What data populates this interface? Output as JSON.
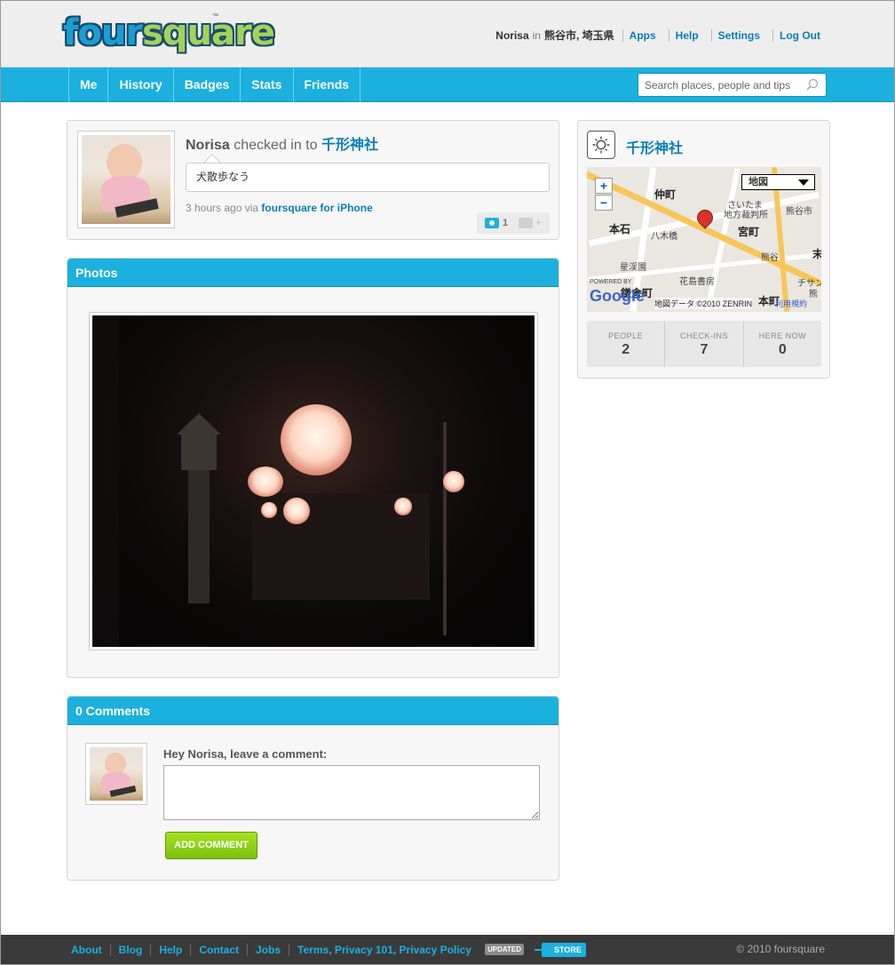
{
  "header": {
    "logo_four": "four",
    "logo_square": "square",
    "logo_tm": "™",
    "user_name": "Norisa",
    "in_word": "in",
    "location": "熊谷市, 埼玉県",
    "links": [
      "Apps",
      "Help",
      "Settings",
      "Log Out"
    ]
  },
  "nav": {
    "items": [
      "Me",
      "History",
      "Badges",
      "Stats",
      "Friends"
    ],
    "search_placeholder": "Search places, people and tips"
  },
  "checkin": {
    "user": "Norisa",
    "action": "checked in to",
    "venue": "千形神社",
    "shout": "犬散歩なう",
    "time": "3 hours ago via",
    "via": "foursquare for iPhone",
    "photo_count": "1",
    "comment_plus": "+"
  },
  "photos": {
    "title": "Photos"
  },
  "comments": {
    "title": "0 Comments",
    "prompt": "Hey Norisa, leave a comment:",
    "button": "ADD COMMENT"
  },
  "venue": {
    "name": "千形神社",
    "map": {
      "type_select": "地図",
      "zoom_in": "+",
      "zoom_out": "−",
      "labels": [
        "仲町",
        "本石",
        "宮町",
        "八木橋",
        "さいたま",
        "地方裁判所",
        "熊谷市",
        "熊谷",
        "星渓園",
        "花島書房",
        "鎌倉町",
        "本町",
        "チサン",
        "熊",
        "末"
      ],
      "google": "Google",
      "copyright": "地図データ ©2010 ZENRIN",
      "terms": "利用規約",
      "powered": "POWERED BY"
    },
    "stats": [
      {
        "label": "PEOPLE",
        "value": "2"
      },
      {
        "label": "CHECK-INS",
        "value": "7"
      },
      {
        "label": "HERE NOW",
        "value": "0"
      }
    ]
  },
  "footer": {
    "links": [
      "About",
      "Blog",
      "Help",
      "Contact",
      "Jobs",
      "Terms, Privacy 101, Privacy Policy"
    ],
    "updated": "UPDATED",
    "store": "STORE",
    "copyright": "© 2010 foursquare"
  },
  "colors": {
    "brand_blue": "#1bb0dd",
    "link_blue": "#0b7db6",
    "button_green": "#8ed11a"
  }
}
